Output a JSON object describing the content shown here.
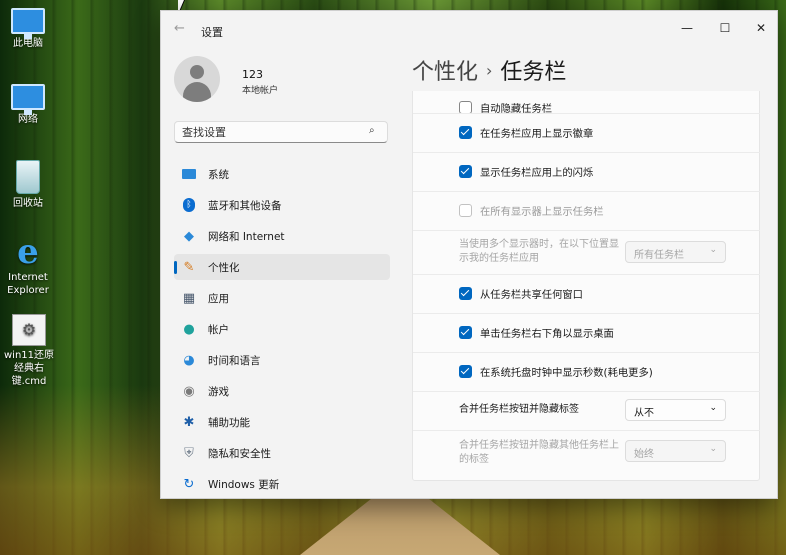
{
  "desktop": {
    "icons": [
      {
        "label": "此电脑"
      },
      {
        "label": "网络"
      },
      {
        "label": "回收站"
      },
      {
        "label": "Internet Explorer"
      },
      {
        "label": "win11还原经典右键.cmd"
      }
    ]
  },
  "window": {
    "app_title": "设置",
    "back_glyph": "←",
    "controls": {
      "minimize": "—",
      "maximize": "☐",
      "close": "✕"
    }
  },
  "user": {
    "name": "123",
    "type": "本地帐户"
  },
  "search": {
    "placeholder": "查找设置",
    "icon": "⌕"
  },
  "nav": {
    "items": [
      {
        "label": "系统",
        "icon": "monitor-icon"
      },
      {
        "label": "蓝牙和其他设备",
        "icon": "bluetooth-icon"
      },
      {
        "label": "网络和 Internet",
        "icon": "wifi-icon"
      },
      {
        "label": "个性化",
        "icon": "brush-icon",
        "active": true
      },
      {
        "label": "应用",
        "icon": "apps-icon"
      },
      {
        "label": "帐户",
        "icon": "person-icon"
      },
      {
        "label": "时间和语言",
        "icon": "globe-clock-icon"
      },
      {
        "label": "游戏",
        "icon": "gamepad-icon"
      },
      {
        "label": "辅助功能",
        "icon": "accessibility-icon"
      },
      {
        "label": "隐私和安全性",
        "icon": "shield-icon"
      },
      {
        "label": "Windows 更新",
        "icon": "update-icon"
      }
    ]
  },
  "header": {
    "parent": "个性化",
    "separator": "›",
    "current": "任务栏"
  },
  "settings": {
    "r0": {
      "label": "自动隐藏任务栏",
      "checked": false
    },
    "r1": {
      "label": "在任务栏应用上显示徽章",
      "checked": true
    },
    "r2": {
      "label": "显示任务栏应用上的闪烁",
      "checked": true
    },
    "r3": {
      "label": "在所有显示器上显示任务栏",
      "checked": false,
      "disabled": true
    },
    "r4": {
      "label": "当使用多个显示器时，在以下位置显示我的任务栏应用",
      "value": "所有任务栏",
      "disabled": true
    },
    "r5": {
      "label": "从任务栏共享任何窗口",
      "checked": true
    },
    "r6": {
      "label": "单击任务栏右下角以显示桌面",
      "checked": true
    },
    "r7": {
      "label": "在系统托盘时钟中显示秒数(耗电更多)",
      "checked": true
    },
    "r8": {
      "label": "合并任务栏按钮并隐藏标签",
      "value": "从不"
    },
    "r9": {
      "label": "合并任务栏按钮并隐藏其他任务栏上的标签",
      "value": "始终",
      "disabled": true
    }
  },
  "dropdown_chevron": "⌄",
  "colors": {
    "accent": "#0067c0"
  }
}
